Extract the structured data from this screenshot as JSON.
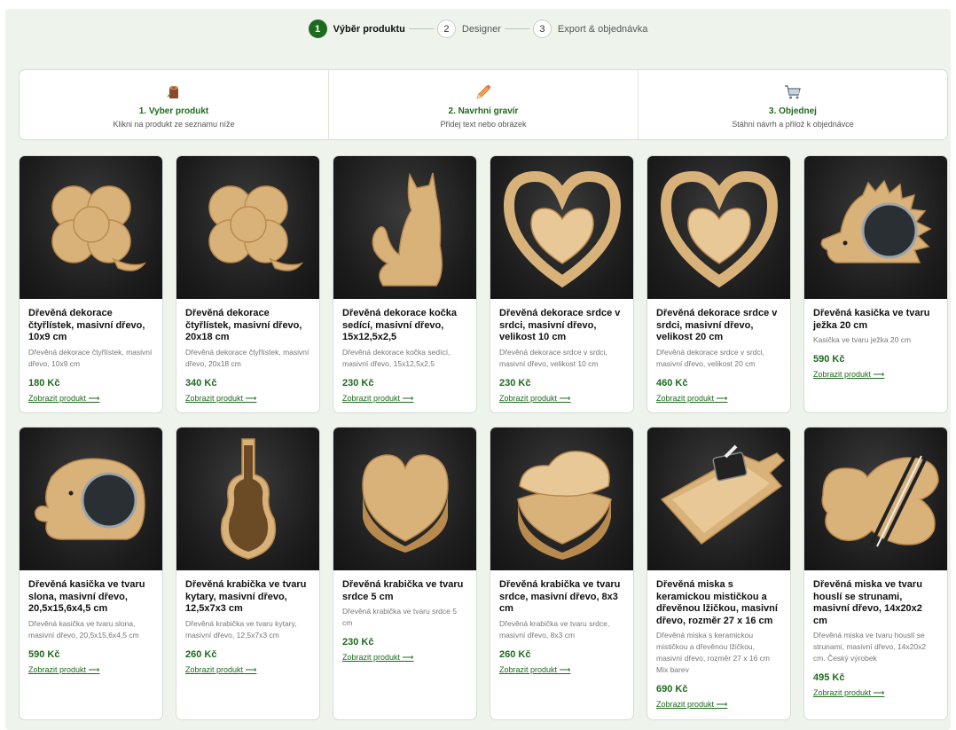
{
  "stepper": {
    "steps": [
      {
        "num": "1",
        "label": "Výběr produktu"
      },
      {
        "num": "2",
        "label": "Designer"
      },
      {
        "num": "3",
        "label": "Export & objednávka"
      }
    ]
  },
  "info": {
    "cols": [
      {
        "icon": "wood-log-icon",
        "title": "1. Vyber produkt",
        "sub": "Klikni na produkt ze seznamu níže"
      },
      {
        "icon": "pencil-icon",
        "title": "2. Navrhni gravír",
        "sub": "Přidej text nebo obrázek"
      },
      {
        "icon": "cart-icon",
        "title": "3. Objednej",
        "sub": "Stáhni návrh a přilož k objednávce"
      }
    ]
  },
  "link_label": "Zobrazit produkt ⟶",
  "products": [
    {
      "title": "Dřevěná dekorace čtyřlístek, masivní dřevo, 10x9 cm",
      "desc": "Dřevěná dekorace čtyřlístek, masivní dřevo, 10x9 cm",
      "price": "180 Kč",
      "shape": "clover"
    },
    {
      "title": "Dřevěná dekorace čtyřlístek, masivní dřevo, 20x18 cm",
      "desc": "Dřevěná dekorace čtyřlístek, masivní dřevo, 20x18 cm",
      "price": "340 Kč",
      "shape": "clover"
    },
    {
      "title": "Dřevěná dekorace kočka sedící, masivní dřevo, 15x12,5x2,5",
      "desc": "Dřevěná dekorace kočka sedící, masivní dřevo, 15x12,5x2,5",
      "price": "230 Kč",
      "shape": "cat"
    },
    {
      "title": "Dřevěná dekorace srdce v srdci, masivní dřevo, velikost 10 cm",
      "desc": "Dřevěná dekorace srdce v srdci, masivní dřevo, velikost 10 cm",
      "price": "230 Kč",
      "shape": "heart-in-heart"
    },
    {
      "title": "Dřevěná dekorace srdce v srdci, masivní dřevo, velikost 20 cm",
      "desc": "Dřevěná dekorace srdce v srdci, masivní dřevo, velikost 20 cm",
      "price": "460 Kč",
      "shape": "heart-in-heart"
    },
    {
      "title": "Dřevěná kasička ve tvaru ježka 20 cm",
      "desc": "Kasička ve tvaru ježka 20 cm",
      "price": "590 Kč",
      "shape": "hedgehog"
    },
    {
      "title": "Dřevěná kasička ve tvaru slona, masivní dřevo, 20,5x15,6x4,5 cm",
      "desc": "Dřevěná kasička ve tvaru slona, masivní dřevo, 20,5x15,6x4,5 cm",
      "price": "590 Kč",
      "shape": "elephant"
    },
    {
      "title": "Dřevěná krabička ve tvaru kytary, masivní dřevo, 12,5x7x3 cm",
      "desc": "Dřevěná krabička ve tvaru kytary, masivní dřevo, 12,5x7x3 cm",
      "price": "260 Kč",
      "shape": "guitar"
    },
    {
      "title": "Dřevěná krabička ve tvaru srdce 5 cm",
      "desc": "Dřevěná krabička ve tvaru srdce 5 cm",
      "price": "230 Kč",
      "shape": "heart-box"
    },
    {
      "title": "Dřevěná krabička ve tvaru srdce, masivní dřevo, 8x3 cm",
      "desc": "Dřevěná krabička ve tvaru srdce, masivní dřevo, 8x3 cm",
      "price": "260 Kč",
      "shape": "heart-box-open"
    },
    {
      "title": "Dřevěná miska s keramickou mističkou a dřevěnou lžičkou, masivní dřevo, rozměr 27 x 16 cm",
      "desc": "Dřevěná miska s keramickou mističkou a dřevěnou lžičkou, masivní dřevo, rozměr 27 x 16 cm Mix barev",
      "price": "690 Kč",
      "shape": "tray"
    },
    {
      "title": "Dřevěná miska ve tvaru houslí se strunami, masivní dřevo, 14x20x2 cm",
      "desc": "Dřevěná miska ve tvaru houslí se strunami, masivní dřevo, 14x20x2 cm. Český výrobek",
      "price": "495 Kč",
      "shape": "violin-bowl"
    }
  ],
  "colors": {
    "accent": "#1e6a1e",
    "wood": "#d9b27a",
    "wood_dark": "#b98a4e",
    "photo_bg": "#1c1c1c"
  }
}
